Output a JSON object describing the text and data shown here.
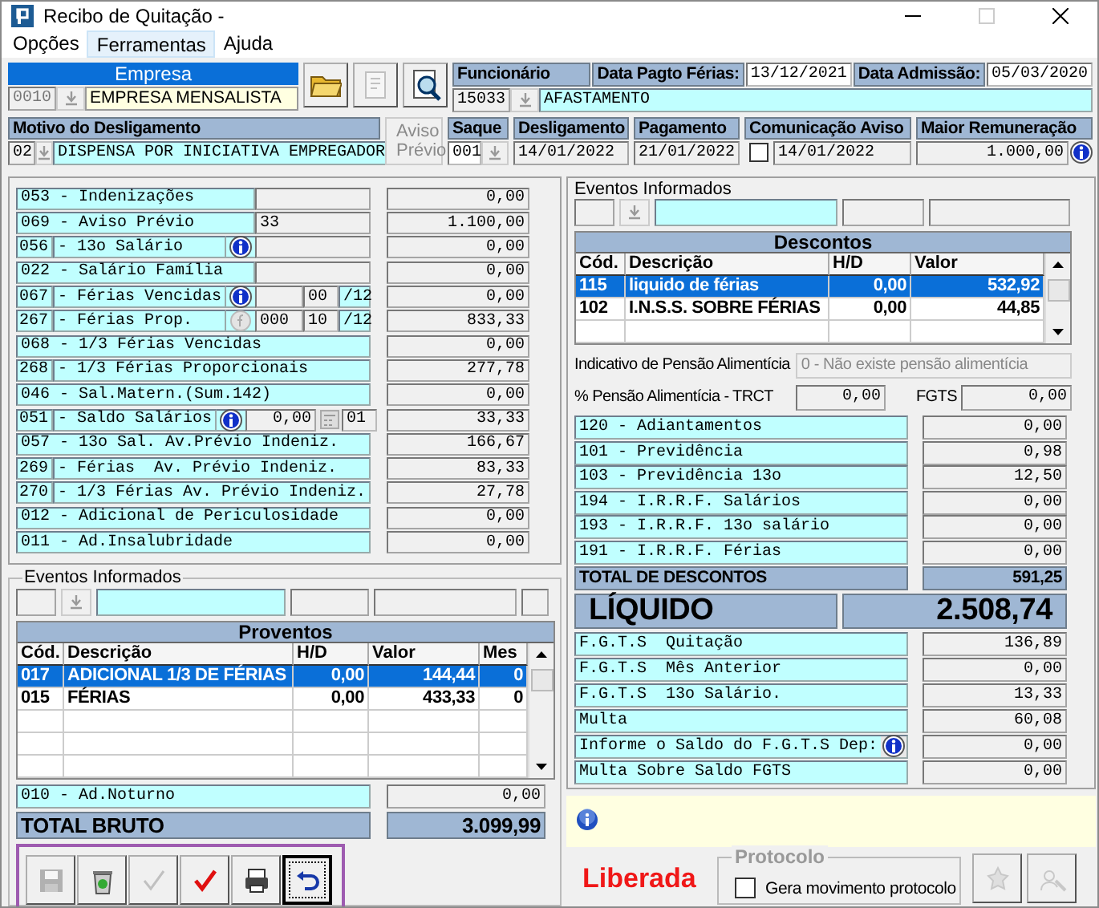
{
  "window": {
    "title": "Recibo de Quitação -"
  },
  "menu": [
    {
      "label": "Opções",
      "selected": false
    },
    {
      "label": "Ferramentas",
      "selected": true
    },
    {
      "label": "Ajuda",
      "selected": false
    }
  ],
  "empresa": {
    "label": "Empresa",
    "code": "0010",
    "name": "EMPRESA MENSALISTA"
  },
  "header_tools": [
    {
      "kind": "open",
      "disabled": false
    },
    {
      "kind": "report",
      "disabled": true
    },
    {
      "kind": "preview",
      "disabled": false
    }
  ],
  "funcionario": {
    "label": "Funcionário",
    "code": "15033",
    "name": "AFASTAMENTO"
  },
  "data_pagto_ferias": {
    "label": "Data Pagto Férias:",
    "value": "13/12/2021"
  },
  "data_admissao": {
    "label": "Data Admissão:",
    "value": "05/03/2020"
  },
  "motivo": {
    "label": "Motivo do Desligamento",
    "code": "02",
    "value": "DISPENSA POR INICIATIVA EMPREGADOR"
  },
  "aviso_previo": {
    "label": "Aviso Prévio",
    "disabled": true
  },
  "saque": {
    "label": "Saque",
    "value": "001"
  },
  "desligamento": {
    "label": "Desligamento",
    "value": "14/01/2022"
  },
  "pagamento": {
    "label": "Pagamento",
    "value": "21/01/2022"
  },
  "comunicacao_aviso": {
    "label": "Comunicação Aviso",
    "checked": false,
    "value": "14/01/2022"
  },
  "maior_remuneracao": {
    "label": "Maior Remuneração",
    "value": "1.000,00"
  },
  "earnings": [
    {
      "label": "053 - Indenizações",
      "extras": [
        {
          "kind": "field"
        }
      ],
      "value": "0,00"
    },
    {
      "label": "069 - Aviso Prévio",
      "extras": [
        {
          "kind": "field",
          "value": "33"
        }
      ],
      "value": "1.100,00"
    },
    {
      "code": "056",
      "label": "- 13o Salário",
      "extras": [
        {
          "kind": "info"
        },
        {
          "kind": "field"
        }
      ],
      "value": "0,00"
    },
    {
      "label": "022 - Salário Família",
      "extras": [
        {
          "kind": "field"
        }
      ],
      "value": "0,00"
    },
    {
      "code": "067",
      "label": "- Férias Vencidas",
      "extras": [
        {
          "kind": "info"
        },
        {
          "kind": "field"
        },
        {
          "kind": "num",
          "value": "00"
        },
        {
          "kind": "suffix",
          "value": "/12"
        }
      ],
      "value": "0,00"
    },
    {
      "code": "267",
      "label": "- Férias Prop.",
      "extras": [
        {
          "kind": "formula"
        },
        {
          "kind": "field",
          "value": "000"
        },
        {
          "kind": "num",
          "value": "10"
        },
        {
          "kind": "suffix",
          "value": "/12"
        }
      ],
      "value": "833,33"
    },
    {
      "label": "068 - 1/3 Férias Vencidas",
      "value": "0,00"
    },
    {
      "code": "268",
      "label": "- 1/3 Férias Proporcionais",
      "value": "277,78"
    },
    {
      "label": "046 - Sal.Matern.(Sum.142)",
      "value": "0,00"
    },
    {
      "code": "051",
      "label": "- Saldo Salários",
      "extras": [
        {
          "kind": "info"
        },
        {
          "kind": "field",
          "value": "0,00"
        },
        {
          "kind": "calc"
        },
        {
          "kind": "num",
          "value": "01"
        }
      ],
      "value": "33,33"
    },
    {
      "label": "057 - 13o Sal. Av.Prévio Indeniz.",
      "value": "166,67"
    },
    {
      "code": "269",
      "label": "- Férias  Av. Prévio Indeniz.",
      "value": "83,33"
    },
    {
      "code": "270",
      "label": "- 1/3 Férias Av. Prévio Indeniz.",
      "value": "27,78"
    },
    {
      "label": "012 - Adicional de Periculosidade",
      "value": "0,00"
    },
    {
      "label": "011 - Ad.Insalubridade",
      "value": "0,00"
    }
  ],
  "eventos_informados_left": {
    "label": "Eventos Informados"
  },
  "proventos": {
    "title": "Proventos",
    "columns": [
      "Cód.",
      "Descrição",
      "H/D",
      "Valor",
      "Mes"
    ],
    "rows": [
      {
        "cells": [
          "017",
          "ADICIONAL 1/3 DE FÉRIAS",
          "0,00",
          "144,44",
          "0"
        ],
        "selected": true
      },
      {
        "cells": [
          "015",
          "FÉRIAS",
          "0,00",
          "433,33",
          "0"
        ],
        "selected": false
      }
    ]
  },
  "ad_noturno": {
    "label": "010 - Ad.Noturno",
    "value": "0,00"
  },
  "total_bruto": {
    "label": "TOTAL BRUTO",
    "value": "3.099,99"
  },
  "toolbar": [
    {
      "kind": "save",
      "disabled": true,
      "focused": false
    },
    {
      "kind": "recycle",
      "disabled": false,
      "focused": false
    },
    {
      "kind": "check",
      "disabled": true,
      "focused": false
    },
    {
      "kind": "confirm",
      "disabled": false,
      "focused": false
    },
    {
      "kind": "print",
      "disabled": false,
      "focused": false
    },
    {
      "kind": "undo",
      "disabled": false,
      "focused": true
    }
  ],
  "eventos_informados_right": {
    "label": "Eventos Informados"
  },
  "descontos": {
    "title": "Descontos",
    "columns": [
      "Cód.",
      "Descrição",
      "H/D",
      "Valor"
    ],
    "rows": [
      {
        "cells": [
          "115",
          "liquido de férias",
          "0,00",
          "532,92"
        ],
        "selected": true
      },
      {
        "cells": [
          "102",
          "I.N.S.S. SOBRE FÉRIAS",
          "0,00",
          "44,85"
        ],
        "selected": false
      }
    ]
  },
  "pensao_indicativo": {
    "label": "Indicativo de Pensão Alimentícia",
    "value": "0 - Não existe pensão alimentícia",
    "disabled": true
  },
  "pensao_percentual": {
    "label": "% Pensão Alimentícia - TRCT",
    "value": "0,00"
  },
  "fgts": {
    "label": "FGTS",
    "value": "0,00"
  },
  "deductions": [
    {
      "label": "120 - Adiantamentos",
      "value": "0,00"
    },
    {
      "label": "101 - Previdência",
      "value": "0,98"
    },
    {
      "label": "103 - Previdência 13o",
      "value": "12,50"
    },
    {
      "label": "194 - I.R.R.F. Salários",
      "value": "0,00"
    },
    {
      "label": "193 - I.R.R.F. 13o salário",
      "value": "0,00"
    },
    {
      "label": "191 - I.R.R.F. Férias",
      "value": "0,00"
    }
  ],
  "total_descontos": {
    "label": "TOTAL DE DESCONTOS",
    "value": "591,25"
  },
  "liquido": {
    "label": "LÍQUIDO",
    "value": "2.508,74"
  },
  "fgts_rows": [
    {
      "label": "F.G.T.S  Quitação",
      "value": "136,89",
      "info": false
    },
    {
      "label": "F.G.T.S  Mês Anterior",
      "value": "0,00",
      "info": false
    },
    {
      "label": "F.G.T.S  13o Salário.",
      "value": "13,33",
      "info": false
    },
    {
      "label": "Multa",
      "value": "60,08",
      "info": false
    },
    {
      "label": "Informe o Saldo do F.G.T.S Dep:",
      "value": "0,00",
      "info": true
    },
    {
      "label": "Multa Sobre Saldo FGTS",
      "value": "0,00",
      "info": false
    }
  ],
  "status": {
    "label": "Liberada"
  },
  "protocolo": {
    "title": "Protocolo",
    "disabled": true,
    "option": {
      "label": "Gera movimento protocolo",
      "checked": false
    }
  },
  "footer_tools": [
    {
      "kind": "process",
      "disabled": true
    },
    {
      "kind": "person-search",
      "disabled": true
    }
  ]
}
